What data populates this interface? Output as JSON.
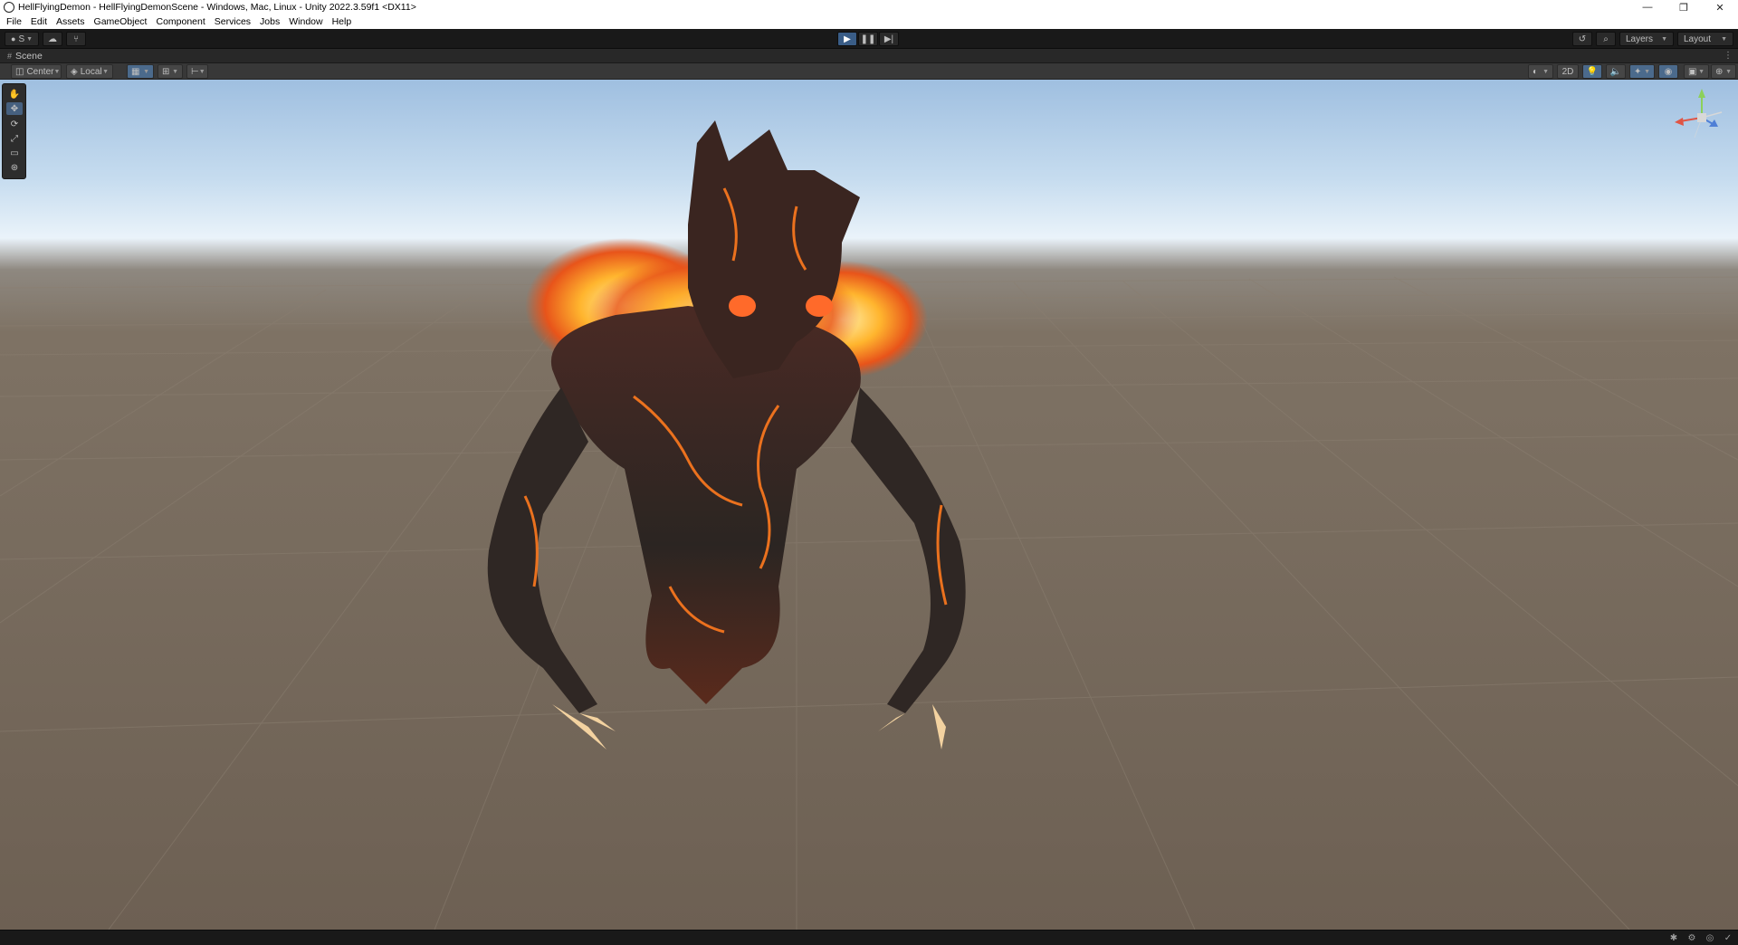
{
  "window": {
    "title": "HellFlyingDemon - HellFlyingDemonScene - Windows, Mac, Linux - Unity 2022.3.59f1 <DX11>",
    "controls": [
      "—",
      "❐",
      "✕"
    ]
  },
  "menu": [
    "File",
    "Edit",
    "Assets",
    "GameObject",
    "Component",
    "Services",
    "Jobs",
    "Window",
    "Help"
  ],
  "toolbar": {
    "account_label": "S",
    "layers_label": "Layers",
    "layout_label": "Layout"
  },
  "scene_tab": {
    "label": "Scene"
  },
  "scene_toolbar": {
    "pivot_label": "Center",
    "space_label": "Local",
    "mode_2d_label": "2D"
  },
  "colors": {
    "accent": "#3a5d87",
    "editor_bg": "#191919",
    "panel_bg": "#383838"
  },
  "icons": {
    "tools": [
      "hand-icon",
      "move-icon",
      "rotate-icon",
      "scale-icon",
      "rect-icon",
      "transform-icon"
    ],
    "play_controls": [
      "play-icon",
      "pause-icon",
      "step-icon"
    ]
  }
}
